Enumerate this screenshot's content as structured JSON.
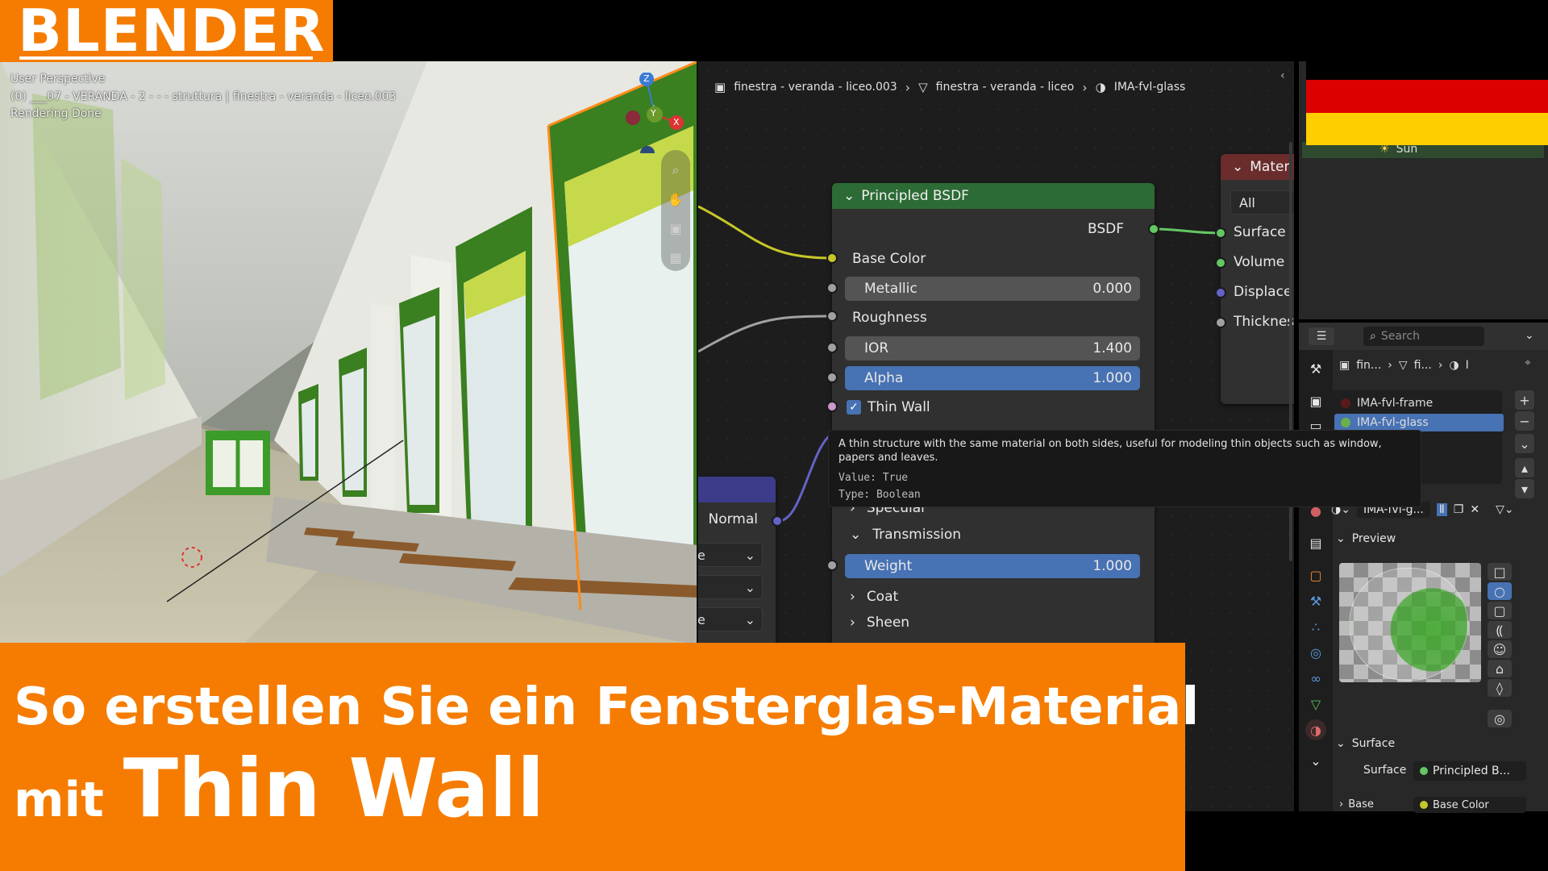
{
  "badge": {
    "label": "BLENDER",
    "color": "#f57c00"
  },
  "viewport": {
    "perspective": "User Perspective",
    "object_path": "(0) ___07 - VERANDA - 2 - - - struttura | finestra - veranda - liceo.003",
    "status": "Rendering Done",
    "gizmo": {
      "z": "Z",
      "y": "Y",
      "x": "X"
    }
  },
  "breadcrumb": {
    "object": "finestra - veranda - liceo.003",
    "mesh": "finestra - veranda - liceo",
    "material": "IMA-fvl-glass"
  },
  "principled": {
    "title": "Principled BSDF",
    "output": "BSDF",
    "base_color": "Base Color",
    "metallic": {
      "label": "Metallic",
      "value": "0.000"
    },
    "roughness": "Roughness",
    "ior": {
      "label": "IOR",
      "value": "1.400"
    },
    "alpha": {
      "label": "Alpha",
      "value": "1.000"
    },
    "thin_wall": "Thin Wall",
    "specular": "Specular",
    "transmission": "Transmission",
    "weight": {
      "label": "Weight",
      "value": "1.000"
    },
    "coat": "Coat",
    "sheen": "Sheen"
  },
  "normal_node": {
    "label": "Normal"
  },
  "tooltip": {
    "description": "A thin structure with the same material on both sides, useful for modeling thin objects such as window, papers and leaves.",
    "value": "Value: True",
    "type": "Type: Boolean"
  },
  "material_output": {
    "title": "Mater",
    "target": "All",
    "surface": "Surface",
    "volume": "Volume",
    "displacement": "Displace",
    "thickness": "Thicknes"
  },
  "outliner": {
    "sun": "Sun"
  },
  "properties": {
    "search_placeholder": "Search",
    "crumb_object": "fin...",
    "crumb_mesh": "fi...",
    "crumb_mat": "I",
    "slots": [
      "IMA-fvl-frame",
      "IMA-fvl-glass"
    ],
    "material_name": "IMA-fvl-g...",
    "preview_label": "Preview",
    "surface_panel": "Surface",
    "surface_label": "Surface",
    "surface_value": "Principled B...",
    "base_label": "Base",
    "base_value": "Base Color"
  },
  "banner": {
    "line1": "So erstellen Sie ein Fensterglas-Material",
    "line2_small": "mit",
    "line2_big": "Thin Wall"
  },
  "colors": {
    "accent_orange": "#f57c00",
    "node_green_header": "#2c6b35",
    "socket_yellow": "#c7c729",
    "socket_gray": "#a1a1a1",
    "socket_purple": "#6363c7",
    "socket_green": "#63c763",
    "field_blue": "#4772b3",
    "flag_black": "#000000",
    "flag_red": "#dd0000",
    "flag_gold": "#ffce00"
  }
}
